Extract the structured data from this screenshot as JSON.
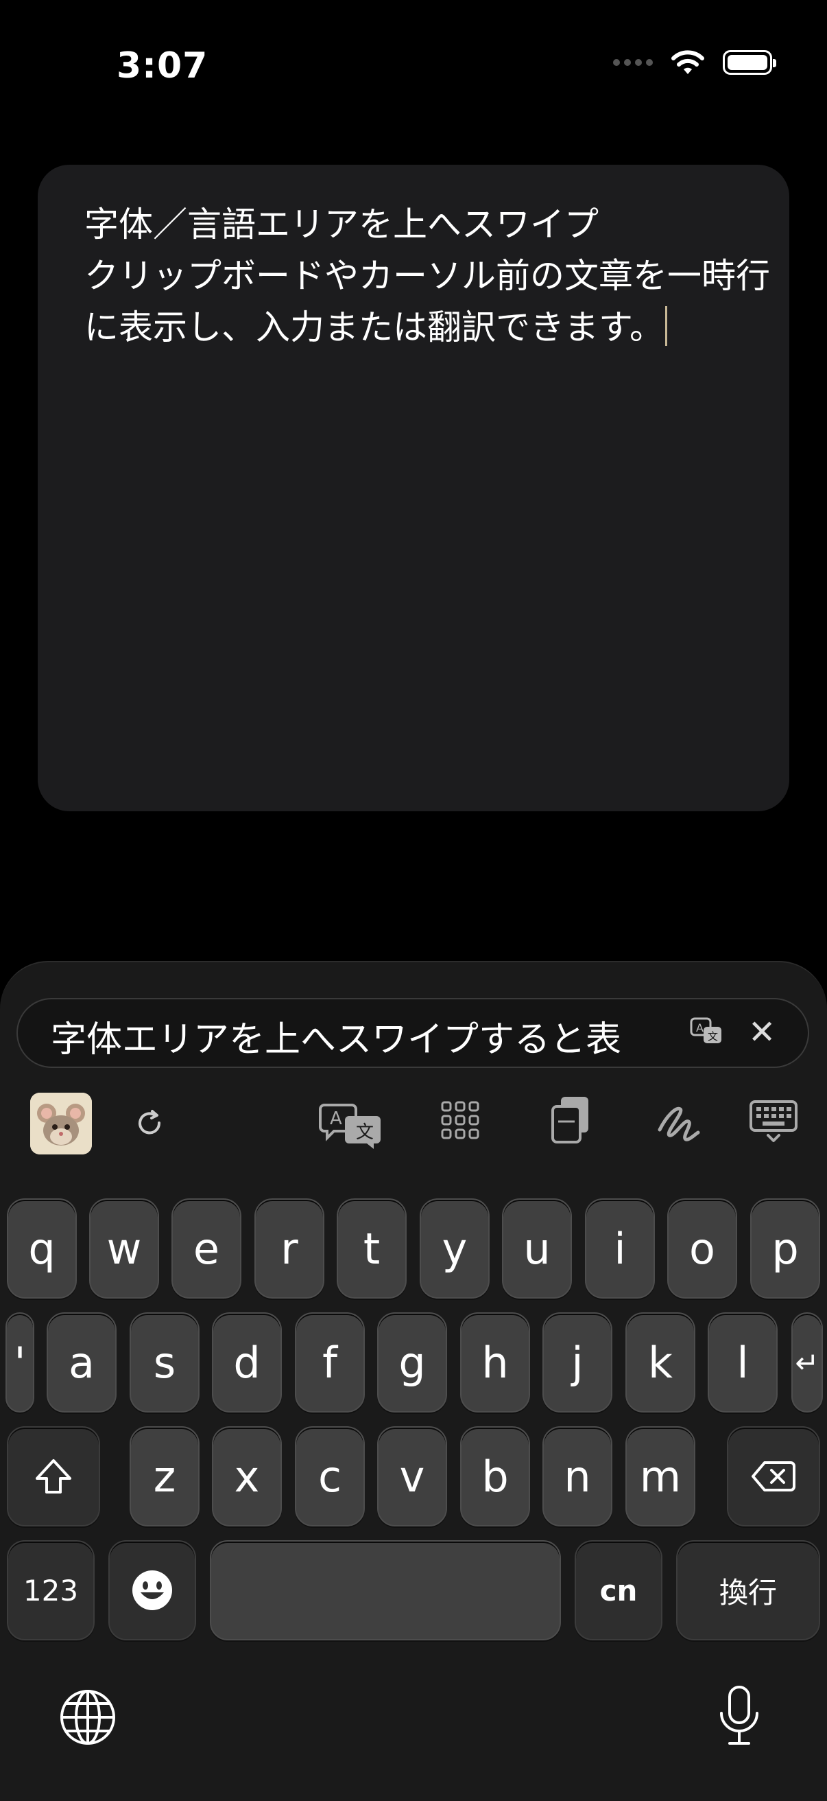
{
  "status_bar": {
    "time": "3:07"
  },
  "editor": {
    "text": "字体／言語エリアを上へスワイプ\nクリップボードやカーソル前の文章を一時行に表示し、入力または翻訳できます。"
  },
  "keyboard": {
    "suggestion_text": "字体エリアを上へスワイプすると表",
    "row1": [
      "q",
      "w",
      "e",
      "r",
      "t",
      "y",
      "u",
      "i",
      "o",
      "p"
    ],
    "row2": [
      "'",
      "a",
      "s",
      "d",
      "f",
      "g",
      "h",
      "j",
      "k",
      "l",
      "↵"
    ],
    "row3": [
      "z",
      "x",
      "c",
      "v",
      "b",
      "n",
      "m"
    ],
    "numbers_label": "123",
    "cn_label": "cn",
    "return_label": "換行"
  },
  "icons": [
    "wifi-icon",
    "battery-icon",
    "translate-icon",
    "close-icon",
    "refresh-icon",
    "grid-icon",
    "clipboard-icon",
    "handwriting-icon",
    "keyboard-hide-icon",
    "shift-icon",
    "backspace-icon",
    "emoji-icon",
    "globe-icon",
    "microphone-icon"
  ]
}
